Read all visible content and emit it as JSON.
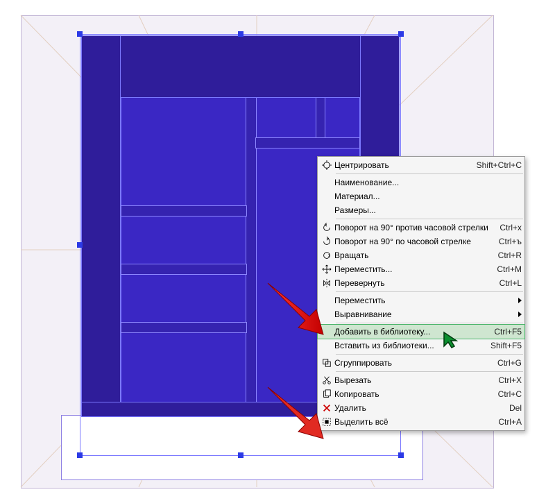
{
  "selection": {
    "handles": 8
  },
  "context_menu": {
    "center": {
      "label": "Центрировать",
      "shortcut": "Shift+Ctrl+C"
    },
    "rename": {
      "label": "Наименование..."
    },
    "material": {
      "label": "Материал..."
    },
    "dimensions": {
      "label": "Размеры..."
    },
    "rot_ccw": {
      "label": "Поворот на 90° против часовой стрелки",
      "shortcut": "Ctrl+x"
    },
    "rot_cw": {
      "label": "Поворот на 90° по часовой стрелке",
      "shortcut": "Ctrl+ъ"
    },
    "rotate": {
      "label": "Вращать",
      "shortcut": "Ctrl+R"
    },
    "move_tool": {
      "label": "Переместить...",
      "shortcut": "Ctrl+M"
    },
    "flip": {
      "label": "Перевернуть",
      "shortcut": "Ctrl+L"
    },
    "move_sub": {
      "label": "Переместить"
    },
    "align_sub": {
      "label": "Выравнивание"
    },
    "add_lib": {
      "label": "Добавить в библиотеку...",
      "shortcut": "Ctrl+F5"
    },
    "paste_lib": {
      "label": "Вставить из библиотеки...",
      "shortcut": "Shift+F5"
    },
    "group": {
      "label": "Сгруппировать",
      "shortcut": "Ctrl+G"
    },
    "cut": {
      "label": "Вырезать",
      "shortcut": "Ctrl+X"
    },
    "copy": {
      "label": "Копировать",
      "shortcut": "Ctrl+C"
    },
    "delete": {
      "label": "Удалить",
      "shortcut": "Del"
    },
    "select_all": {
      "label": "Выделить всё",
      "shortcut": "Ctrl+A"
    }
  }
}
